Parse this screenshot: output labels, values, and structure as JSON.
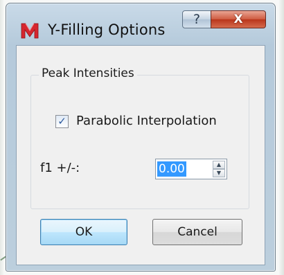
{
  "window": {
    "title": "Y-Filling Options",
    "help_glyph": "?",
    "close_glyph": "X"
  },
  "group": {
    "title": "Peak Intensities"
  },
  "parabolic": {
    "label": "Parabolic Interpolation",
    "checked": true,
    "check_glyph": "✓"
  },
  "f1": {
    "label": "f1 +/-:",
    "value": "0.00",
    "up_glyph": "▲",
    "down_glyph": "▼"
  },
  "buttons": {
    "ok": "OK",
    "cancel": "Cancel"
  },
  "colors": {
    "title_bar": "#b5cadb",
    "close_button": "#c5442a",
    "selection": "#3399ff",
    "logo": "#d6262f"
  },
  "icons": {
    "app": "app-logo-icon",
    "help": "help-icon",
    "close": "close-icon",
    "check": "checkmark-icon",
    "spin_up": "spin-up-icon",
    "spin_down": "spin-down-icon"
  }
}
